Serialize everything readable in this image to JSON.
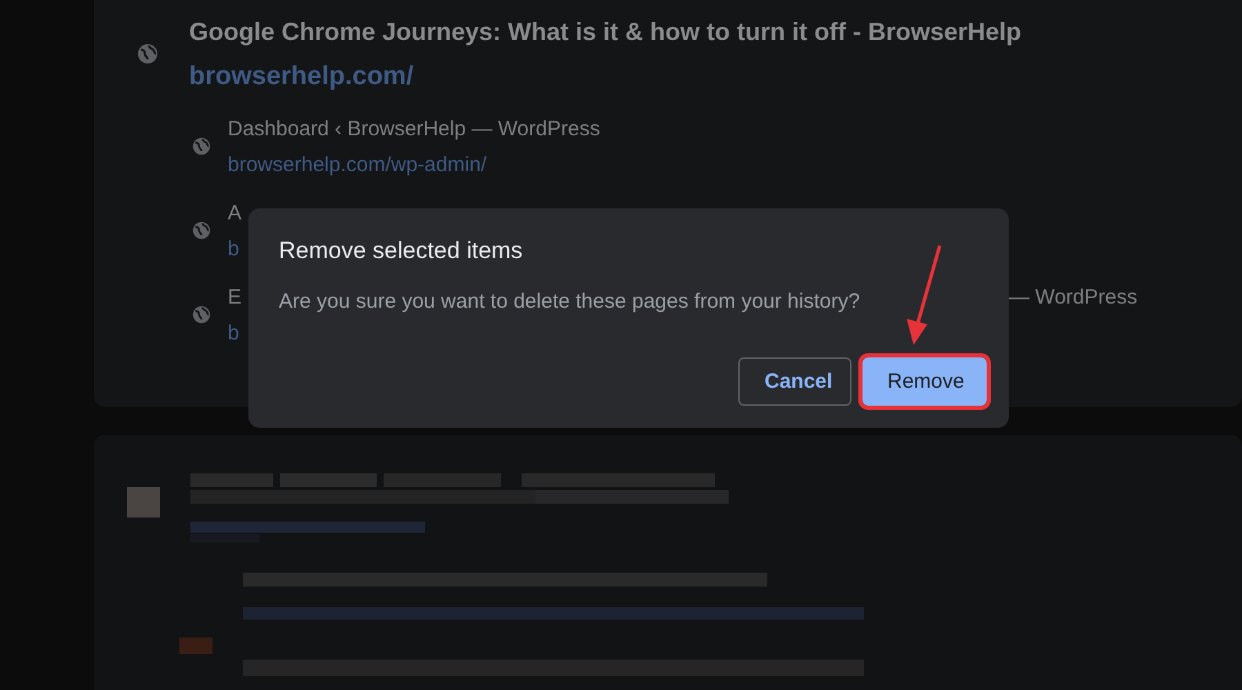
{
  "history_group": {
    "title": "Google Chrome Journeys: What is it & how to turn it off - BrowserHelp",
    "url": "browserhelp.com/",
    "items": [
      {
        "title": "Dashboard ‹ BrowserHelp — WordPress",
        "url": "browserhelp.com/wp-admin/"
      },
      {
        "title": "A",
        "url": "b"
      },
      {
        "title": "E",
        "url": "b",
        "title_tail": "— WordPress"
      }
    ]
  },
  "dialog": {
    "title": "Remove selected items",
    "message": "Are you sure you want to delete these pages from your history?",
    "buttons": [
      {
        "label": "Cancel",
        "kind": "secondary",
        "highlighted": false
      },
      {
        "label": "Remove",
        "kind": "primary",
        "highlighted": true
      }
    ]
  }
}
